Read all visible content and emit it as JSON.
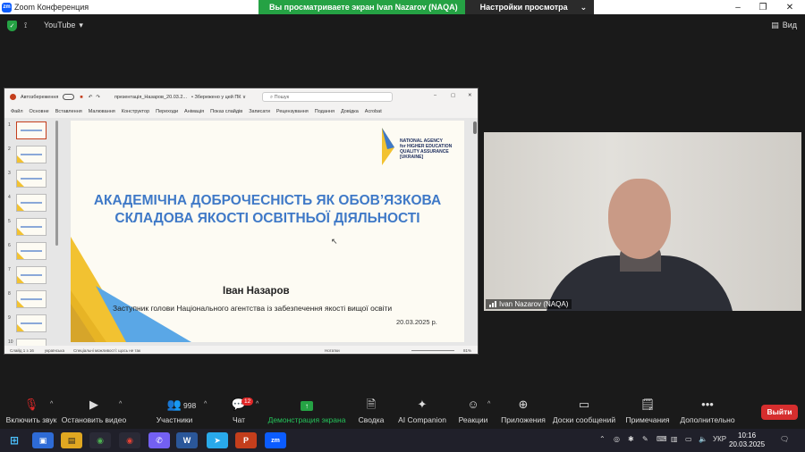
{
  "window": {
    "title": "Zoom Конференция",
    "logo_text": "zm"
  },
  "share_banner": {
    "status": "Вы просматриваете экран Ivan Nazarov (NAQA)",
    "settings": "Настройки просмотра",
    "chevron": "⌄"
  },
  "window_controls": {
    "minimize": "–",
    "restore": "❐",
    "close": "✕"
  },
  "topbar": {
    "source": "YouTube",
    "view_label": "Вид"
  },
  "ppt": {
    "autosave": "Автозбереження",
    "file_name": "презентація_Назаров_20.03.2...",
    "saved_state": "• Збережено у цей ПК ∨",
    "search_placeholder": "Пошук",
    "menu": [
      "Файл",
      "Основне",
      "Вставлення",
      "Малювання",
      "Конструктор",
      "Переходи",
      "Анімація",
      "Показ слайдів",
      "Записати",
      "Рецензування",
      "Подання",
      "Довідка",
      "Acrobat"
    ],
    "thumb_numbers": [
      "1",
      "2",
      "3",
      "4",
      "5",
      "6",
      "7",
      "8",
      "9",
      "10"
    ],
    "status": {
      "slide_count": "Слайд 1 з 16",
      "language": "українська",
      "accessibility": "Спеціальні можливості: щось не так",
      "notes": "Нотатки",
      "zoom": "81%"
    }
  },
  "slide": {
    "title_line1": "АКАДЕМІЧНА ДОБРОЧЕСНІСТЬ ЯК ОБОВ’ЯЗКОВА",
    "title_line2": "СКЛАДОВА ЯКОСТІ ОСВІТНЬОЇ ДІЯЛЬНОСТІ",
    "logo_lines": [
      "NATIONAL AGENCY",
      "for HIGHER EDUCATION",
      "QUALITY ASSURANCE",
      "[UKRAINE]"
    ],
    "author": "Іван Назаров",
    "position": "Заступник голови Національного агентства із забезпечення якості вищої освіти",
    "date": "20.03.2025 р."
  },
  "video": {
    "participant_name": "Ivan Nazarov (NAQA)"
  },
  "toolbar": {
    "unmute": "Включить звук",
    "stop_video": "Остановить видео",
    "participants": "Участники",
    "participants_count": "998",
    "chat": "Чат",
    "chat_badge": "12",
    "share_screen": "Демонстрация экрана",
    "summary": "Сводка",
    "companion": "AI Companion",
    "reactions": "Реакции",
    "apps": "Приложения",
    "whiteboards": "Доски сообщений",
    "notes": "Примечания",
    "more": "Дополнительно",
    "leave": "Выйти"
  },
  "taskbar": {
    "apps": [
      "⊞",
      "▣",
      "▤",
      "◉",
      "◉",
      "✆",
      "W",
      "➤",
      "P",
      "zm"
    ],
    "language": "УКР",
    "time": "10:16",
    "date": "20.03.2025"
  },
  "colors": {
    "share_green": "#25a244",
    "leave_red": "#d62e2e",
    "slide_title": "#3f79c7",
    "zoom_blue": "#0b5cff"
  }
}
